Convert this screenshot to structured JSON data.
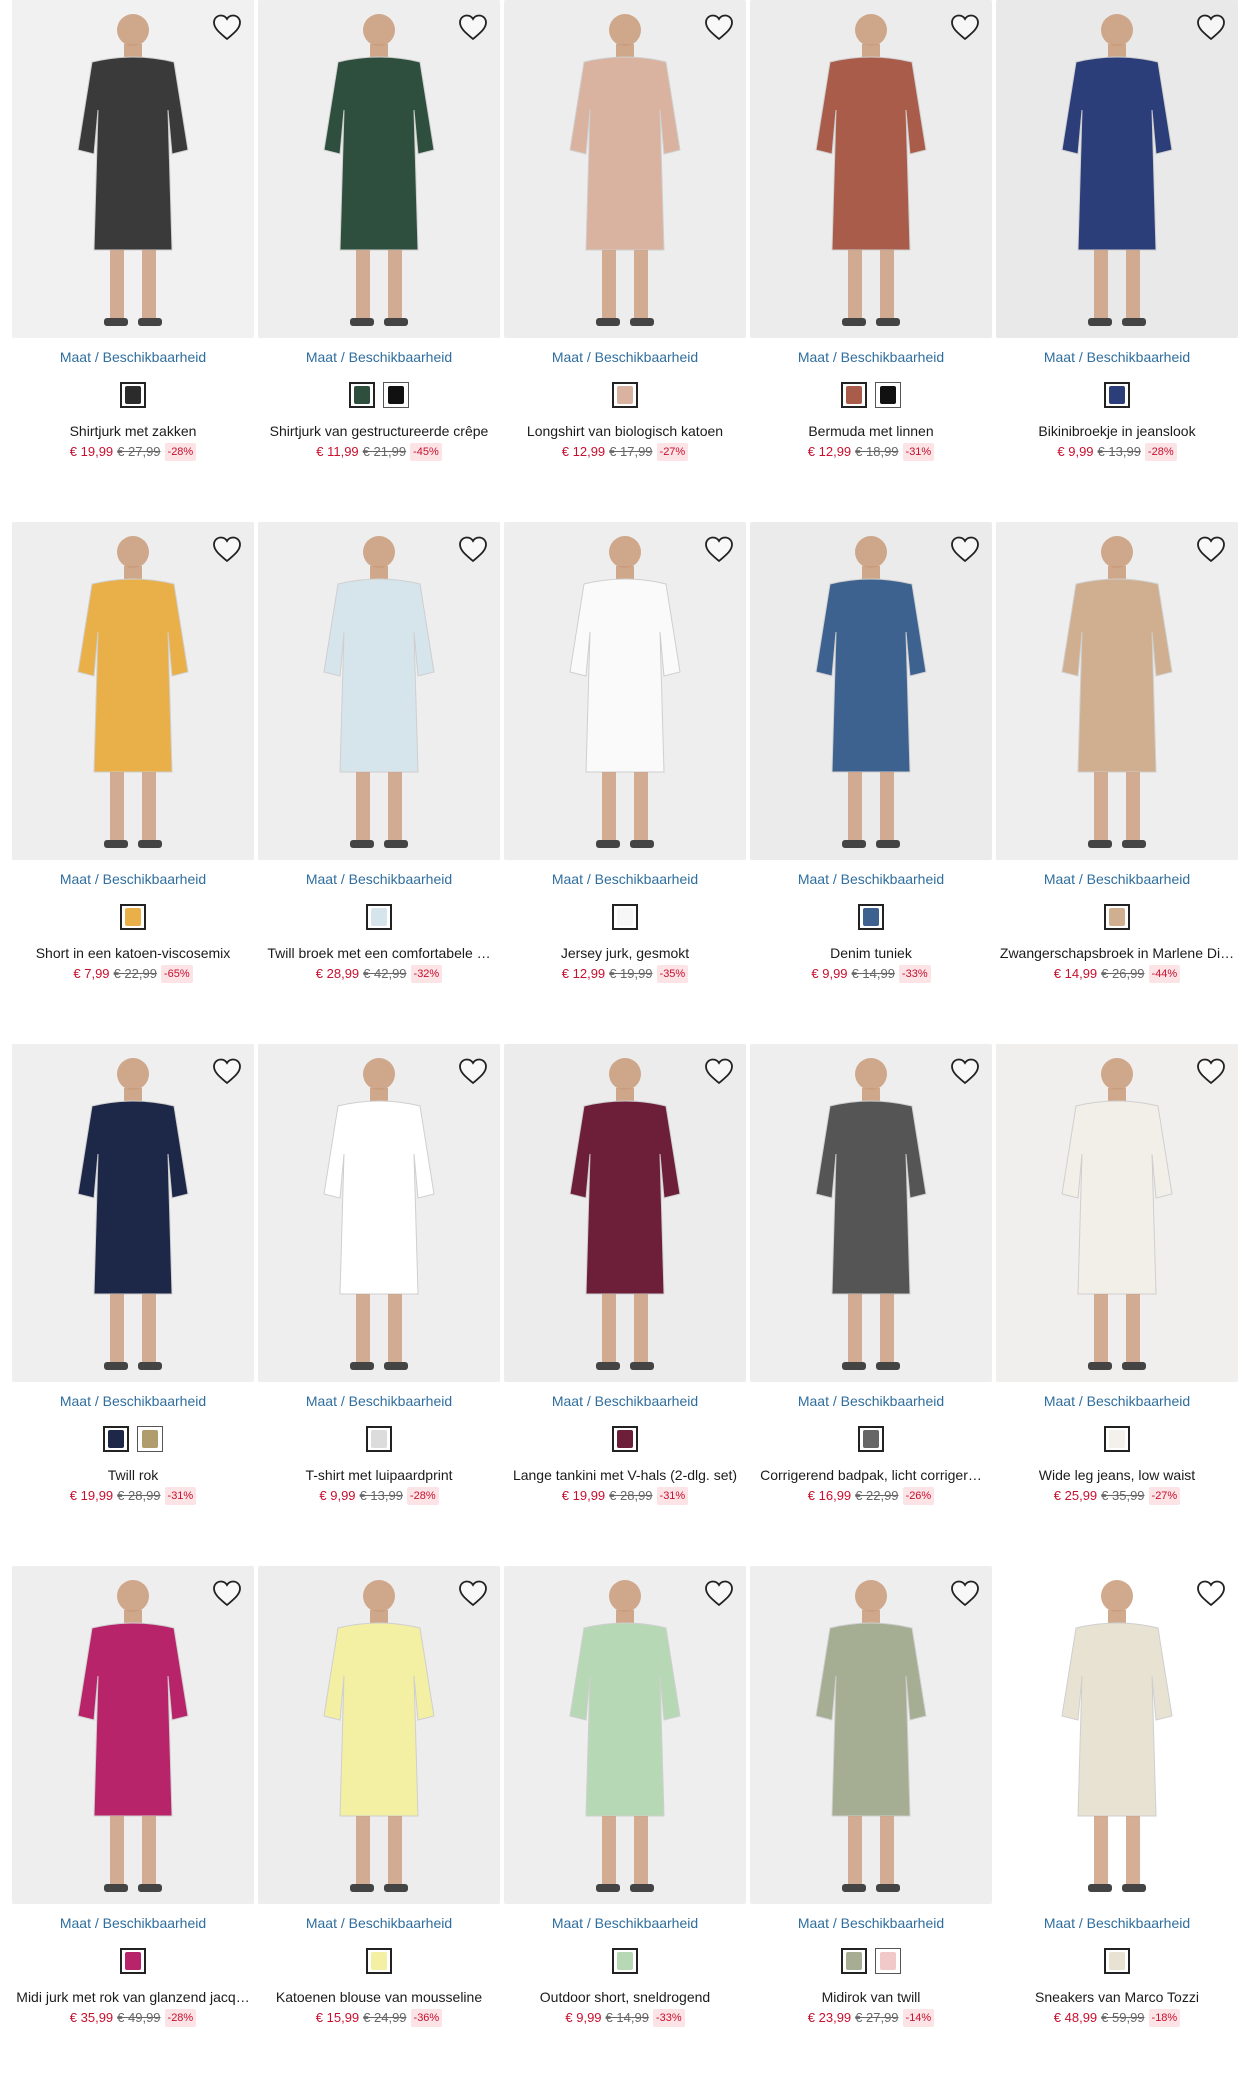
{
  "labels": {
    "maat": "Maat",
    "sep": "/",
    "beschikbaarheid": "Beschikbaarheid"
  },
  "products": [
    {
      "name": "Shirtjurk met zakken",
      "price": "€ 19,99",
      "old_price": "€ 27,99",
      "discount": "-28%",
      "bg": "#f1f1f1",
      "garment": "#3a3a3a",
      "swatches": [
        "#2b2b2b"
      ]
    },
    {
      "name": "Shirtjurk van gestructureerde crêpe",
      "price": "€ 11,99",
      "old_price": "€ 21,99",
      "discount": "-45%",
      "bg": "#eeeeee",
      "garment": "#2f4f3e",
      "swatches": [
        "#2f4f3e",
        "#111111"
      ]
    },
    {
      "name": "Longshirt van biologisch katoen",
      "price": "€ 12,99",
      "old_price": "€ 17,99",
      "discount": "-27%",
      "bg": "#ededed",
      "garment": "#d9b3a0",
      "swatches": [
        "#d9b3a0"
      ]
    },
    {
      "name": "Bermuda met linnen",
      "price": "€ 12,99",
      "old_price": "€ 18,99",
      "discount": "-31%",
      "bg": "#ececec",
      "garment": "#a95c4a",
      "swatches": [
        "#a95c4a",
        "#111111"
      ]
    },
    {
      "name": "Bikinibroekje in jeanslook",
      "price": "€ 9,99",
      "old_price": "€ 13,99",
      "discount": "-28%",
      "bg": "#e9e9e9",
      "garment": "#2c3e7a",
      "swatches": [
        "#2c3e7a"
      ]
    },
    {
      "name": "Short in een katoen-viscosemix",
      "price": "€ 7,99",
      "old_price": "€ 22,99",
      "discount": "-65%",
      "bg": "#eeeeee",
      "garment": "#e9b04a",
      "swatches": [
        "#e9b04a"
      ]
    },
    {
      "name": "Twill broek met een comfortabele …",
      "price": "€ 28,99",
      "old_price": "€ 42,99",
      "discount": "-32%",
      "bg": "#eeeeee",
      "garment": "#d6e4ec",
      "swatches": [
        "#d6e4ec"
      ]
    },
    {
      "name": "Jersey jurk, gesmokt",
      "price": "€ 12,99",
      "old_price": "€ 19,99",
      "discount": "-35%",
      "bg": "#eeeeee",
      "garment": "#fafafa",
      "swatches": [
        "#f7f7f7"
      ]
    },
    {
      "name": "Denim tuniek",
      "price": "€ 9,99",
      "old_price": "€ 14,99",
      "discount": "-33%",
      "bg": "#ebebeb",
      "garment": "#3e6290",
      "swatches": [
        "#3e6290"
      ]
    },
    {
      "name": "Zwangerschapsbroek in Marlene Di…",
      "price": "€ 14,99",
      "old_price": "€ 26,99",
      "discount": "-44%",
      "bg": "#eeeeee",
      "garment": "#cfaf8f",
      "swatches": [
        "#cfaf8f"
      ]
    },
    {
      "name": "Twill rok",
      "price": "€ 19,99",
      "old_price": "€ 28,99",
      "discount": "-31%",
      "bg": "#efefef",
      "garment": "#1d2748",
      "swatches": [
        "#1d2748",
        "#b09c6d"
      ]
    },
    {
      "name": "T-shirt met luipaardprint",
      "price": "€ 9,99",
      "old_price": "€ 13,99",
      "discount": "-28%",
      "bg": "#eeeeee",
      "garment": "#ffffff",
      "swatches": [
        "#dcdcdc"
      ]
    },
    {
      "name": "Lange tankini met V-hals (2-dlg. set)",
      "price": "€ 19,99",
      "old_price": "€ 28,99",
      "discount": "-31%",
      "bg": "#ececec",
      "garment": "#6d1f3a",
      "swatches": [
        "#6d1f3a"
      ]
    },
    {
      "name": "Corrigerend badpak, licht corriger…",
      "price": "€ 16,99",
      "old_price": "€ 22,99",
      "discount": "-26%",
      "bg": "#eeeeee",
      "garment": "#555555",
      "swatches": [
        "#666666"
      ]
    },
    {
      "name": "Wide leg jeans, low waist",
      "price": "€ 25,99",
      "old_price": "€ 35,99",
      "discount": "-27%",
      "bg": "#f0efed",
      "garment": "#f2efe9",
      "swatches": [
        "#f4f1ec"
      ]
    },
    {
      "name": "Midi jurk met rok van glanzend jacq…",
      "price": "€ 35,99",
      "old_price": "€ 49,99",
      "discount": "-28%",
      "bg": "#eeeeee",
      "garment": "#b8246a",
      "swatches": [
        "#b8246a"
      ]
    },
    {
      "name": "Katoenen blouse van mousseline",
      "price": "€ 15,99",
      "old_price": "€ 24,99",
      "discount": "-36%",
      "bg": "#ededed",
      "garment": "#f3efa3",
      "swatches": [
        "#f3efa3"
      ]
    },
    {
      "name": "Outdoor short, sneldrogend",
      "price": "€ 9,99",
      "old_price": "€ 14,99",
      "discount": "-33%",
      "bg": "#eeeeee",
      "garment": "#b7d8b4",
      "swatches": [
        "#b7d8b4"
      ]
    },
    {
      "name": "Midirok van twill",
      "price": "€ 23,99",
      "old_price": "€ 27,99",
      "discount": "-14%",
      "bg": "#eeeeee",
      "garment": "#a5ae92",
      "swatches": [
        "#a5ae92",
        "#f1c9c9"
      ]
    },
    {
      "name": "Sneakers van Marco Tozzi",
      "price": "€ 48,99",
      "old_price": "€ 59,99",
      "discount": "-18%",
      "bg": "#ffffff",
      "garment": "#e8e2d3",
      "swatches": [
        "#e8e2d3"
      ]
    }
  ]
}
